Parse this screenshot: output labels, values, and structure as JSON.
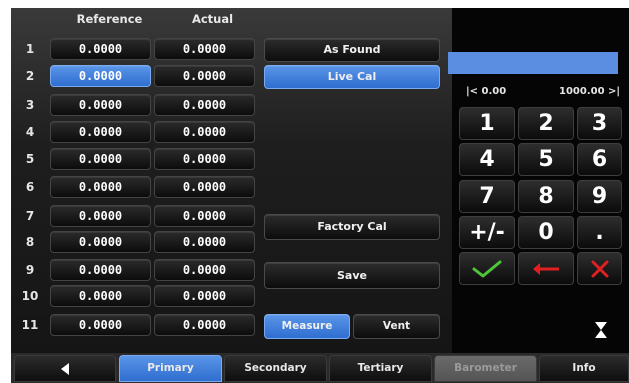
{
  "table": {
    "header_reference": "Reference",
    "header_actual": "Actual",
    "rows": [
      {
        "num": "1",
        "reference": "0.0000",
        "actual": "0.0000"
      },
      {
        "num": "2",
        "reference": "0.0000",
        "actual": "0.0000"
      },
      {
        "num": "3",
        "reference": "0.0000",
        "actual": "0.0000"
      },
      {
        "num": "4",
        "reference": "0.0000",
        "actual": "0.0000"
      },
      {
        "num": "5",
        "reference": "0.0000",
        "actual": "0.0000"
      },
      {
        "num": "6",
        "reference": "0.0000",
        "actual": "0.0000"
      },
      {
        "num": "7",
        "reference": "0.0000",
        "actual": "0.0000"
      },
      {
        "num": "8",
        "reference": "0.0000",
        "actual": "0.0000"
      },
      {
        "num": "9",
        "reference": "0.0000",
        "actual": "0.0000"
      },
      {
        "num": "10",
        "reference": "0.0000",
        "actual": "0.0000"
      },
      {
        "num": "11",
        "reference": "0.0000",
        "actual": "0.0000"
      }
    ]
  },
  "buttons": {
    "as_found": "As Found",
    "live_cal": "Live Cal",
    "factory_cal": "Factory Cal",
    "save": "Save",
    "measure": "Measure",
    "vent": "Vent"
  },
  "keypad": {
    "range_min": "|< 0.00",
    "range_max": "1000.00 >|",
    "keys": [
      "1",
      "2",
      "3",
      "4",
      "5",
      "6",
      "7",
      "8",
      "9",
      "+/-",
      "0",
      "."
    ],
    "enter_icon": "check-icon",
    "backspace_icon": "left-arrow-icon",
    "clear_icon": "x-icon"
  },
  "nav": {
    "back_icon": "back-arrow-icon",
    "tabs": [
      "Primary",
      "Secondary",
      "Tertiary",
      "Barometer",
      "Info"
    ]
  },
  "colors": {
    "accent_blue": "#4a86e0",
    "check_green": "#4fc43a",
    "backspace_red": "#e02020"
  }
}
